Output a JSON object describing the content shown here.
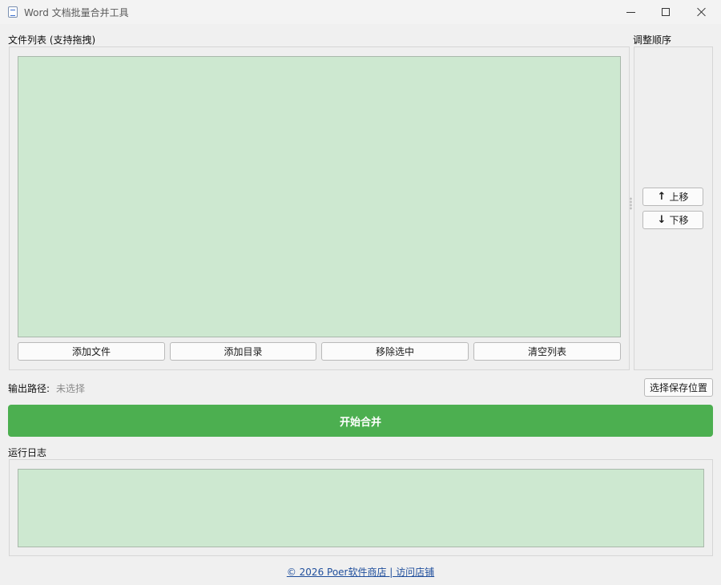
{
  "window": {
    "title": "Word 文档批量合并工具",
    "icon": "word-document-icon"
  },
  "file_list": {
    "label": "文件列表 (支持拖拽)",
    "buttons": {
      "add_file": "添加文件",
      "add_dir": "添加目录",
      "remove_selected": "移除选中",
      "clear_list": "清空列表"
    }
  },
  "order": {
    "label": "调整顺序",
    "up_icon": "↑",
    "up_label": "上移",
    "down_icon": "↓",
    "down_label": "下移"
  },
  "output": {
    "label": "输出路径:",
    "value": "未选择",
    "choose_button": "选择保存位置"
  },
  "start_button": "开始合并",
  "log": {
    "label": "运行日志"
  },
  "footer": {
    "link_text": "© 2026 Poer软件商店 | 访问店铺"
  },
  "colors": {
    "accent_green": "#4caf50",
    "list_background": "#cde8d0",
    "link_blue": "#1f4e9c"
  }
}
